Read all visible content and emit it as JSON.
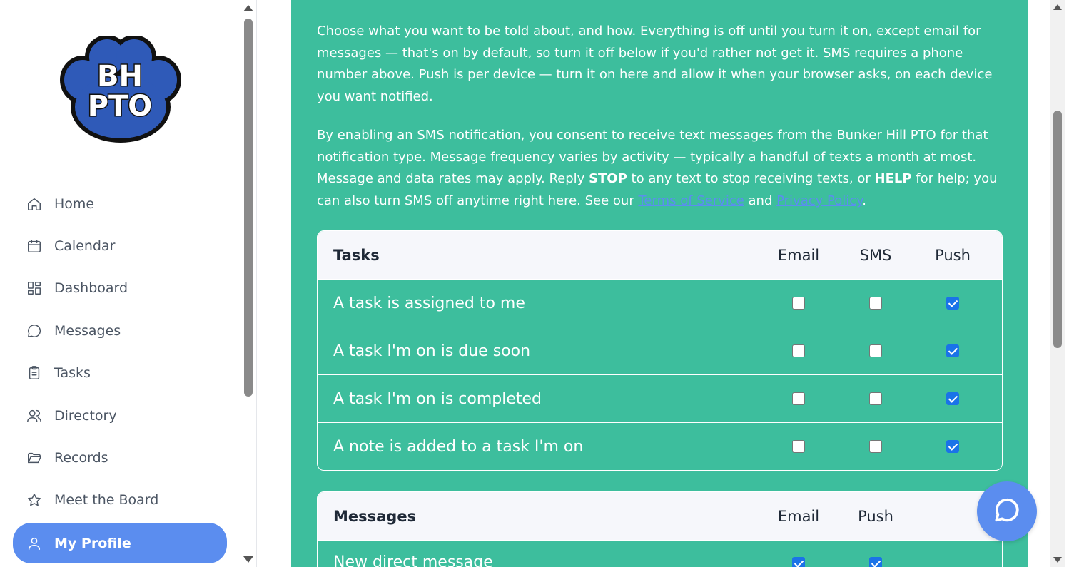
{
  "logo": {
    "line1": "BH",
    "line2": "PTO"
  },
  "sidebar": {
    "items": [
      {
        "label": "Home",
        "icon": "home-icon"
      },
      {
        "label": "Calendar",
        "icon": "calendar-icon"
      },
      {
        "label": "Dashboard",
        "icon": "dashboard-icon"
      },
      {
        "label": "Messages",
        "icon": "message-icon"
      },
      {
        "label": "Tasks",
        "icon": "clipboard-icon"
      },
      {
        "label": "Directory",
        "icon": "users-icon"
      },
      {
        "label": "Records",
        "icon": "folder-icon"
      },
      {
        "label": "Meet the Board",
        "icon": "star-icon"
      },
      {
        "label": "My Profile",
        "icon": "user-icon",
        "active": true
      }
    ]
  },
  "intro": {
    "p1": "Choose what you want to be told about, and how. Everything is off until you turn it on, except email for messages — that's on by default, so turn it off below if you'd rather not get it. SMS requires a phone number above. Push is per device — turn it on here and allow it when your browser asks, on each device you want notified.",
    "p2_a": "By enabling an SMS notification, you consent to receive text messages from the Bunker Hill PTO for that notification type. Message frequency varies by activity — typically a handful of texts a month at most. Message and data rates may apply. Reply ",
    "p2_stop": "STOP",
    "p2_b": " to any text to stop receiving texts, or ",
    "p2_help": "HELP",
    "p2_c": " for help; you can also turn SMS off anytime right here. See our ",
    "terms_link": "Terms of Service",
    "p2_and": " and ",
    "privacy_link": "Privacy Policy",
    "p2_end": "."
  },
  "tasks_table": {
    "title": "Tasks",
    "columns": [
      "Email",
      "SMS",
      "Push"
    ],
    "rows": [
      {
        "label": "A task is assigned to me",
        "email": false,
        "sms": false,
        "push": true
      },
      {
        "label": "A task I'm on is due soon",
        "email": false,
        "sms": false,
        "push": true
      },
      {
        "label": "A task I'm on is completed",
        "email": false,
        "sms": false,
        "push": true
      },
      {
        "label": "A note is added to a task I'm on",
        "email": false,
        "sms": false,
        "push": true
      }
    ]
  },
  "messages_table": {
    "title": "Messages",
    "columns": [
      "Email",
      "Push"
    ],
    "rows": [
      {
        "label": "New direct message",
        "email": true,
        "push": true
      }
    ]
  },
  "colors": {
    "accent": "#5b8def",
    "panel": "#3dbe9d",
    "checkbox_on": "#1a73e8"
  }
}
